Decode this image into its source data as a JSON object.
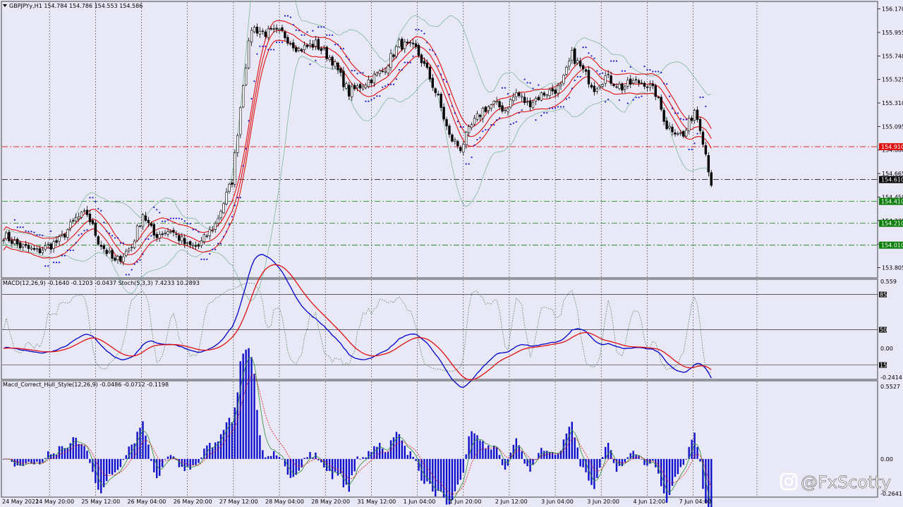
{
  "chart_data": [
    {
      "type": "candlestick",
      "panel": "main",
      "header": "GBPJPYy,H1  154.784 154.786 154.553 154.586",
      "y_ticks": [
        "156.170",
        "155.955",
        "155.740",
        "155.525",
        "155.310",
        "155.095",
        "154.880",
        "154.665",
        "154.450",
        "154.235",
        "154.020",
        "153.805"
      ],
      "price_range": [
        153.75,
        156.2
      ],
      "levels": [
        {
          "label": "154.910",
          "value": 154.91,
          "color": "#e01010",
          "style": "dashdot"
        },
        {
          "label": "154.610",
          "value": 154.61,
          "color": "#000000",
          "style": "dashdot"
        },
        {
          "label": "154.410",
          "value": 154.41,
          "color": "#0b7d0b",
          "style": "dashdot"
        },
        {
          "label": "154.210",
          "value": 154.21,
          "color": "#0b7d0b",
          "style": "dashdot"
        },
        {
          "label": "154.010",
          "value": 154.01,
          "color": "#0b7d0b",
          "style": "dashdot"
        }
      ],
      "anchors": [
        [
          0,
          154.1
        ],
        [
          6,
          154.0
        ],
        [
          12,
          153.95
        ],
        [
          20,
          154.05
        ],
        [
          26,
          154.25
        ],
        [
          30,
          154.3
        ],
        [
          34,
          154.05
        ],
        [
          40,
          153.85
        ],
        [
          46,
          154.0
        ],
        [
          50,
          154.3
        ],
        [
          54,
          154.1
        ],
        [
          60,
          154.15
        ],
        [
          66,
          154.0
        ],
        [
          70,
          154.0
        ],
        [
          76,
          154.2
        ],
        [
          82,
          154.6
        ],
        [
          86,
          155.5
        ],
        [
          89,
          156.0
        ],
        [
          94,
          155.95
        ],
        [
          100,
          155.95
        ],
        [
          106,
          155.8
        ],
        [
          112,
          155.85
        ],
        [
          118,
          155.7
        ],
        [
          124,
          155.4
        ],
        [
          130,
          155.5
        ],
        [
          136,
          155.6
        ],
        [
          142,
          155.85
        ],
        [
          148,
          155.8
        ],
        [
          152,
          155.6
        ],
        [
          156,
          155.35
        ],
        [
          160,
          155.0
        ],
        [
          164,
          154.9
        ],
        [
          168,
          155.1
        ],
        [
          172,
          155.25
        ],
        [
          176,
          155.3
        ],
        [
          180,
          155.25
        ],
        [
          184,
          155.4
        ],
        [
          188,
          155.3
        ],
        [
          194,
          155.4
        ],
        [
          200,
          155.45
        ],
        [
          204,
          155.75
        ],
        [
          208,
          155.6
        ],
        [
          212,
          155.45
        ],
        [
          216,
          155.55
        ],
        [
          222,
          155.45
        ],
        [
          226,
          155.5
        ],
        [
          230,
          155.5
        ],
        [
          234,
          155.4
        ],
        [
          238,
          155.1
        ],
        [
          242,
          155.05
        ],
        [
          244,
          155.0
        ],
        [
          248,
          155.25
        ],
        [
          250,
          155.1
        ],
        [
          252,
          154.85
        ],
        [
          254,
          154.58
        ]
      ],
      "x_ticks": [
        "24 May 2021",
        "24 May 20:00",
        "25 May 12:00",
        "26 May 04:00",
        "26 May 20:00",
        "27 May 12:00",
        "28 May 04:00",
        "28 May 20:00",
        "31 May 12:00",
        "1 Jun 04:00",
        "1 Jun 20:00",
        "2 Jun 12:00",
        "3 Jun 04:00",
        "3 Jun 20:00",
        "4 Jun 12:00",
        "7 Jun 04:00"
      ],
      "indicators": [
        "Bollinger Bands",
        "Envelopes",
        "Parabolic SAR"
      ]
    },
    {
      "type": "line",
      "panel": "macd_stoch",
      "header": "MACD(12,26,9) -0.1640 -0.1203 -0.0437  Stoch(5,3,3) 7.4233 10.2893",
      "y_ticks": [
        "0.559",
        "0.00",
        "-0.2414"
      ],
      "y_range": [
        -0.2414,
        0.559
      ],
      "stoch_levels": [
        {
          "label": "85",
          "value": 85
        },
        {
          "label": "50",
          "value": 50
        },
        {
          "label": "15",
          "value": 15
        }
      ],
      "series": [
        {
          "name": "MACD",
          "color": "#0000cc"
        },
        {
          "name": "Signal",
          "color": "#e01010"
        },
        {
          "name": "Stoch",
          "color": "#6a8f6a"
        }
      ]
    },
    {
      "type": "bar",
      "panel": "hull",
      "header": "Macd_Correct_Hull_Style(12,26,9) -0.0486 -0.0712 -0.1198",
      "y_ticks": [
        "0.5527",
        "0.00",
        "-0.2641"
      ],
      "y_range": [
        -0.2641,
        0.5527
      ],
      "series": [
        {
          "name": "Histogram",
          "color": "#1010cc"
        },
        {
          "name": "Main",
          "color": "#2e8b2e"
        },
        {
          "name": "Signal",
          "color": "#e01010"
        }
      ]
    }
  ],
  "watermark": "@FxScotty",
  "colors": {
    "background": "#e8e8f6",
    "bull": "#ffffff",
    "bear": "#000000",
    "band": "#e01010",
    "bollinger": "#7fb89a",
    "sar": "#1a1acc"
  }
}
